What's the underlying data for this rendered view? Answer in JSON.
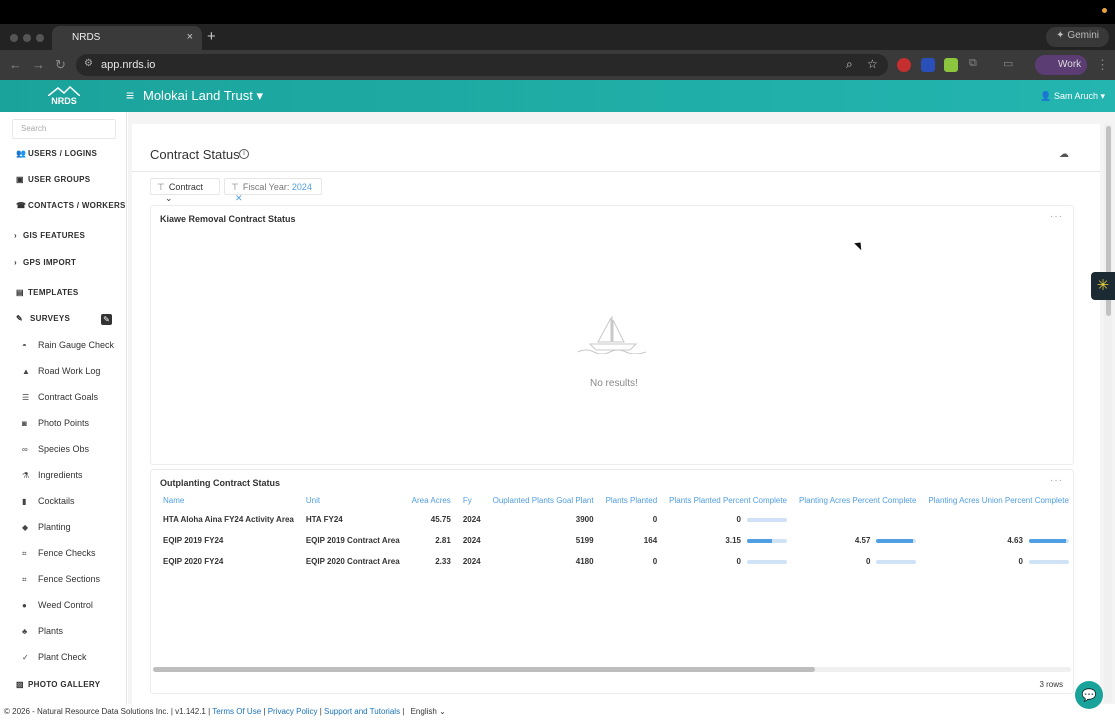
{
  "browser": {
    "tab_title": "NRDS",
    "tab_close": "×",
    "new_tab": "+",
    "gemini_label": "Gemini",
    "url": "app.nrds.io",
    "profile_label": "Work"
  },
  "app": {
    "logo_text": "NRDS",
    "org_name": "Molokai Land Trust",
    "user_name": "Sam Aruch",
    "accent_color": "#1aa39b"
  },
  "sidebar": {
    "search_placeholder": "Search",
    "top_items": [
      {
        "label": "USERS / LOGINS",
        "icon": "users-icon"
      },
      {
        "label": "USER GROUPS",
        "icon": "user-groups-icon"
      },
      {
        "label": "CONTACTS / WORKERS",
        "icon": "phone-icon"
      },
      {
        "label": "GIS FEATURES",
        "icon": "chevron-right-icon"
      },
      {
        "label": "GPS IMPORT",
        "icon": "chevron-right-icon"
      },
      {
        "label": "TEMPLATES",
        "icon": "document-icon"
      },
      {
        "label": "SURVEYS",
        "icon": "surveys-icon"
      }
    ],
    "survey_items": [
      {
        "label": "Rain Gauge Check",
        "icon": "gauge-icon"
      },
      {
        "label": "Road Work Log",
        "icon": "road-icon"
      },
      {
        "label": "Contract Goals",
        "icon": "list-icon"
      },
      {
        "label": "Photo Points",
        "icon": "camera-icon"
      },
      {
        "label": "Species Obs",
        "icon": "binoculars-icon"
      },
      {
        "label": "Ingredients",
        "icon": "flask-icon"
      },
      {
        "label": "Cocktails",
        "icon": "bottle-icon"
      },
      {
        "label": "Planting",
        "icon": "trowel-icon"
      },
      {
        "label": "Fence Checks",
        "icon": "fence-icon"
      },
      {
        "label": "Fence Sections",
        "icon": "fence-section-icon"
      },
      {
        "label": "Weed Control",
        "icon": "spray-icon"
      },
      {
        "label": "Plants",
        "icon": "leaf-icon"
      },
      {
        "label": "Plant Check",
        "icon": "check-icon"
      }
    ],
    "bottom_item": {
      "label": "PHOTO GALLERY",
      "icon": "image-icon"
    }
  },
  "page": {
    "title": "Contract Status",
    "filters": {
      "contract_label": "Contract",
      "fiscal_year_label": "Fiscal Year:",
      "fiscal_year_value": "2024"
    }
  },
  "kiawe_panel": {
    "title": "Kiawe Removal Contract Status",
    "empty_text": "No results!"
  },
  "outplanting_panel": {
    "title": "Outplanting Contract Status",
    "columns": [
      "Name",
      "Unit",
      "Area Acres",
      "Fy",
      "Ouplanted Plants Goal Plant",
      "Plants Planted",
      "Plants Planted Percent Complete",
      "Planting Acres Percent Complete",
      "Planting Acres Union Percent Complete"
    ],
    "rows": [
      {
        "name": "HTA Aloha Aina FY24 Activity Area",
        "unit": "HTA FY24",
        "area": "45.75",
        "fy": "2024",
        "goal": "3900",
        "planted": "0",
        "pct": "0",
        "pct_value": 0,
        "acres_pct": "",
        "acres_pct_value": null,
        "union_pct": "",
        "union_pct_value": null
      },
      {
        "name": "EQIP 2019 FY24",
        "unit": "EQIP 2019 Contract Area",
        "area": "2.81",
        "fy": "2024",
        "goal": "5199",
        "planted": "164",
        "pct": "3.15",
        "pct_value": 3.15,
        "acres_pct": "4.57",
        "acres_pct_value": 4.57,
        "union_pct": "4.63",
        "union_pct_value": 4.63
      },
      {
        "name": "EQIP 2020 FY24",
        "unit": "EQIP 2020 Contract Area",
        "area": "2.33",
        "fy": "2024",
        "goal": "4180",
        "planted": "0",
        "pct": "0",
        "pct_value": 0,
        "acres_pct": "0",
        "acres_pct_value": 0,
        "union_pct": "0",
        "union_pct_value": 0
      }
    ],
    "row_count": "3 rows"
  },
  "footer": {
    "copyright": "© 2026 - Natural Resource Data Solutions Inc. | v1.142.1 |",
    "terms": "Terms Of Use",
    "privacy": "Privacy Policy",
    "support": "Support and Tutorials",
    "language": "English"
  }
}
